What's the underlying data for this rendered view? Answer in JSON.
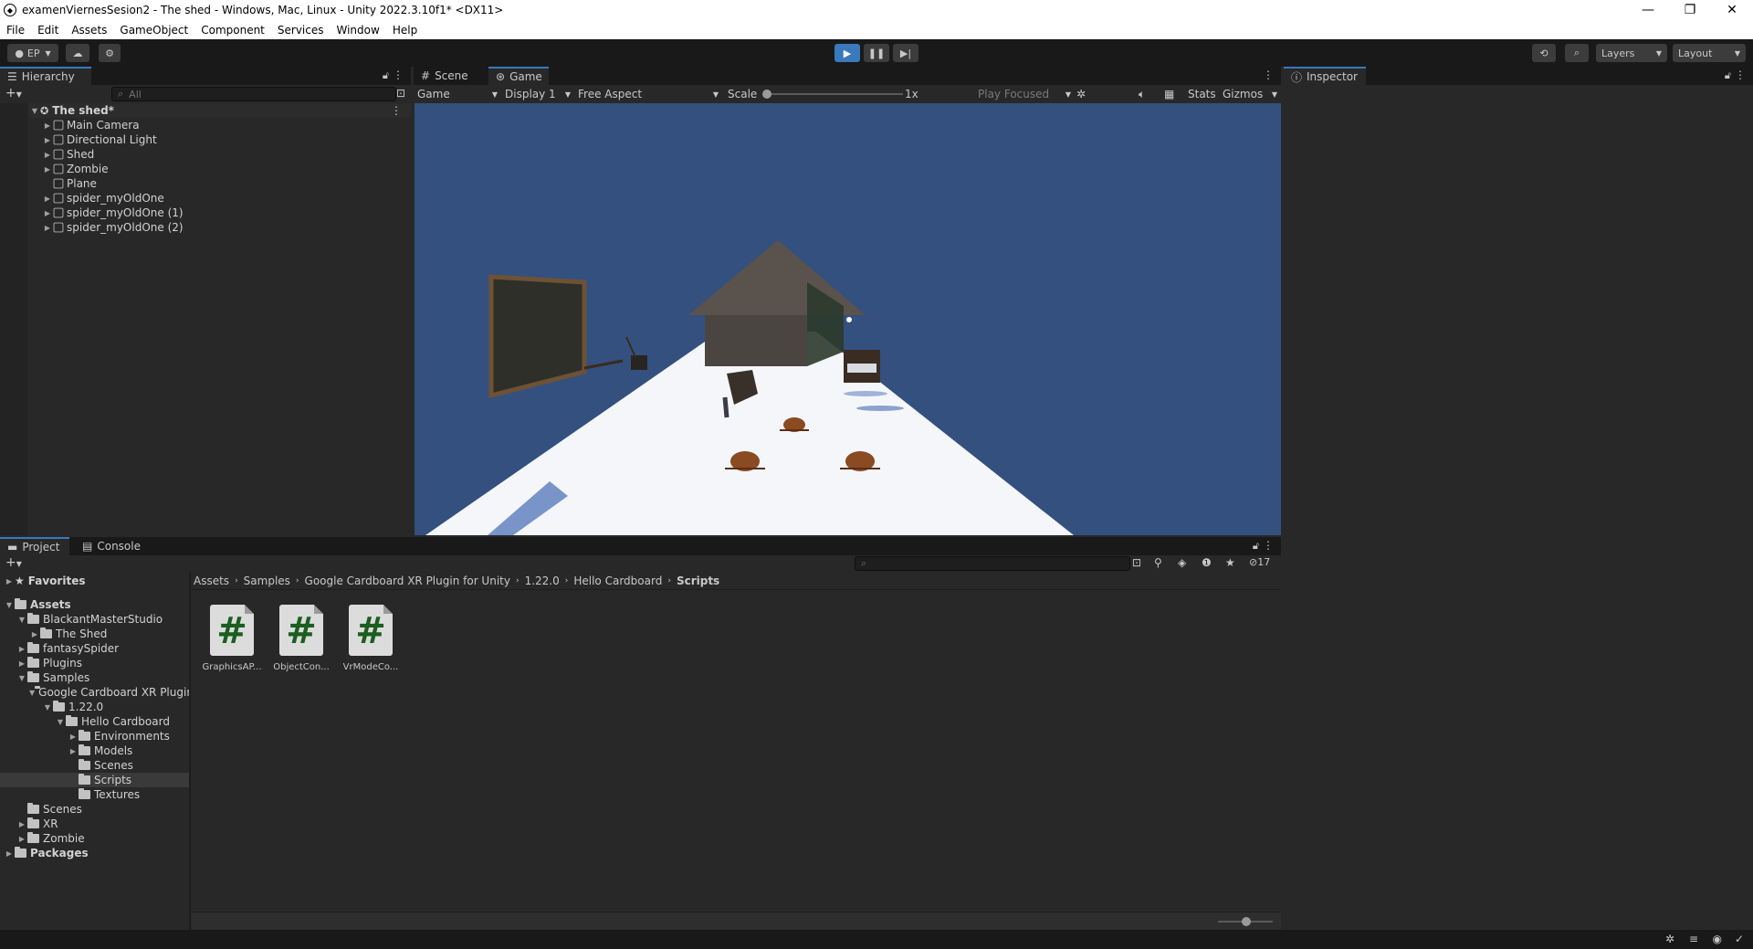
{
  "window": {
    "title": "examenViernesSesion2 - The shed - Windows, Mac, Linux - Unity 2022.3.10f1* <DX11>",
    "controls": [
      "—",
      "❐",
      "✕"
    ]
  },
  "menu": [
    "File",
    "Edit",
    "Assets",
    "GameObject",
    "Component",
    "Services",
    "Window",
    "Help"
  ],
  "toolbar": {
    "account": "EP",
    "layers": "Layers",
    "layout": "Layout",
    "accent": "#3a79bb"
  },
  "hierarchy": {
    "tab": "Hierarchy",
    "search_placeholder": "All",
    "scene": "The shed*",
    "items": [
      "Main Camera",
      "Directional Light",
      "Shed",
      "Zombie",
      "Plane",
      "spider_myOldOne",
      "spider_myOldOne (1)",
      "spider_myOldOne (2)"
    ]
  },
  "game_view": {
    "tabs": [
      "Scene",
      "Game"
    ],
    "mode": "Game",
    "display": "Display 1",
    "aspect": "Free Aspect",
    "scale_label": "Scale",
    "scale_value": "1x",
    "play_focused": "Play Focused",
    "stats": "Stats",
    "gizmos": "Gizmos",
    "sky_color": "#33507f"
  },
  "inspector": {
    "tab": "Inspector"
  },
  "project": {
    "tabs": [
      "Project",
      "Console"
    ],
    "hidden_count": "17",
    "favorites": "Favorites",
    "tree": [
      {
        "label": "Assets",
        "bold": true
      },
      {
        "label": "BlackantMasterStudio"
      },
      {
        "label": "The Shed"
      },
      {
        "label": "fantasySpider"
      },
      {
        "label": "Plugins"
      },
      {
        "label": "Samples"
      },
      {
        "label": "Google Cardboard XR Plugin for Unity"
      },
      {
        "label": "1.22.0"
      },
      {
        "label": "Hello Cardboard"
      },
      {
        "label": "Environments"
      },
      {
        "label": "Models"
      },
      {
        "label": "Scenes"
      },
      {
        "label": "Scripts",
        "selected": true
      },
      {
        "label": "Textures"
      },
      {
        "label": "Scenes"
      },
      {
        "label": "XR"
      },
      {
        "label": "Zombie"
      },
      {
        "label": "Packages",
        "bold": true
      }
    ],
    "breadcrumb": [
      "Assets",
      "Samples",
      "Google Cardboard XR Plugin for Unity",
      "1.22.0",
      "Hello Cardboard",
      "Scripts"
    ],
    "files": [
      "GraphicsAP...",
      "ObjectCon...",
      "VrModeCo..."
    ]
  }
}
